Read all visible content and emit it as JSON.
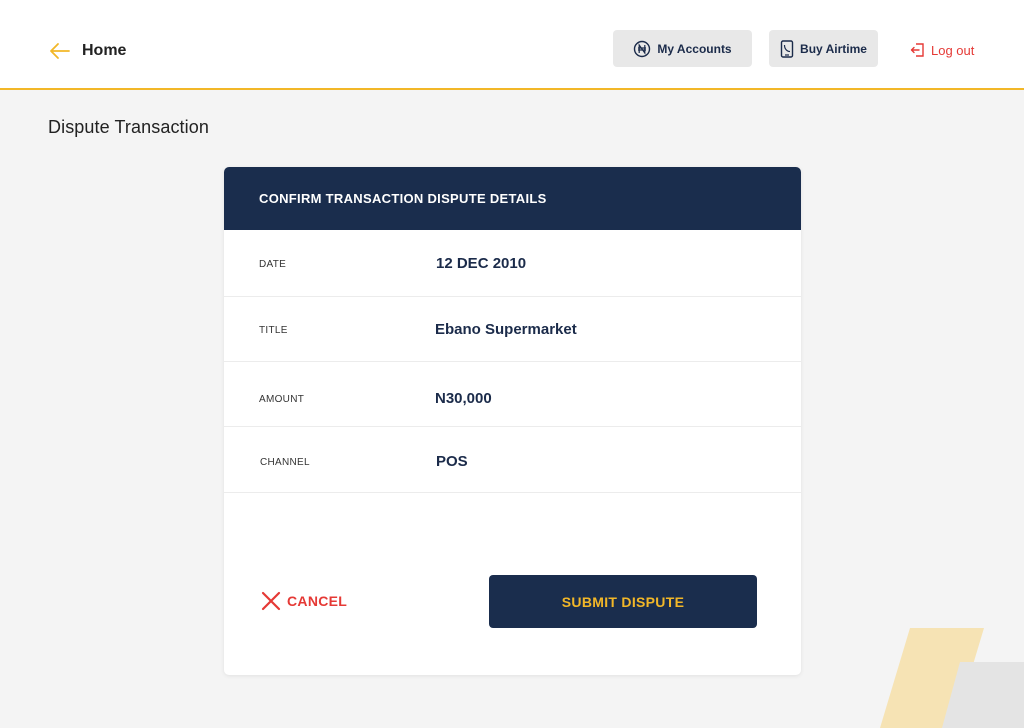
{
  "header": {
    "home_label": "Home",
    "my_accounts_label": "My Accounts",
    "buy_airtime_label": "Buy Airtime",
    "logout_label": "Log out"
  },
  "page": {
    "title": "Dispute Transaction"
  },
  "card": {
    "heading": "CONFIRM TRANSACTION DISPUTE DETAILS",
    "rows": [
      {
        "key": "DATE",
        "value": "12 DEC 2010"
      },
      {
        "key": "TITLE",
        "value": "Ebano Supermarket"
      },
      {
        "key": "AMOUNT",
        "value": "N30,000"
      },
      {
        "key": "CHANNEL",
        "value": "POS"
      }
    ],
    "cancel_label": "CANCEL",
    "submit_label": "SUBMIT DISPUTE"
  },
  "icons": {
    "back": "arrow-left-icon",
    "accounts": "naira-circle-icon",
    "airtime": "phone-icon",
    "logout": "logout-icon",
    "cancel": "close-icon"
  },
  "colors": {
    "navy": "#1a2d4d",
    "accent_yellow": "#f2b728",
    "danger_red": "#e53935",
    "background": "#f4f4f4"
  }
}
